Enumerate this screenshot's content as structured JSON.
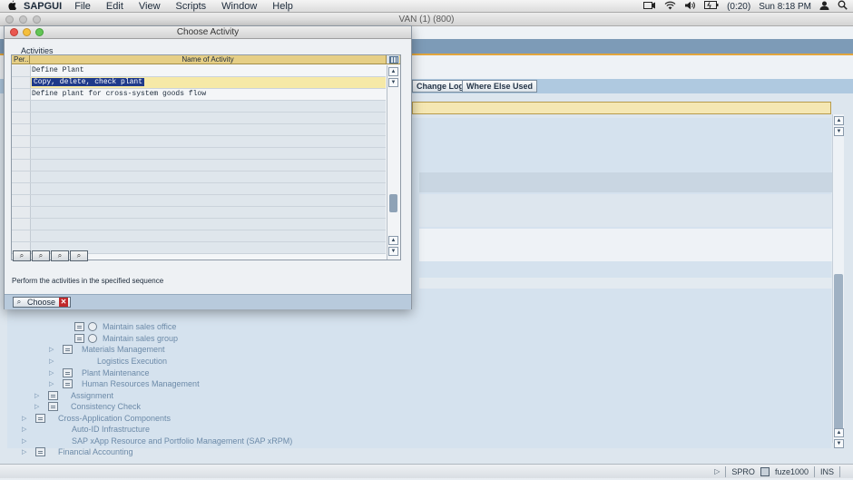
{
  "menubar": {
    "app": "SAPGUI",
    "items": [
      "File",
      "Edit",
      "View",
      "Scripts",
      "Window",
      "Help"
    ],
    "battery": "(0:20)",
    "clock": "Sun 8:18 PM"
  },
  "background_window": {
    "title": "VAN (1) (800)",
    "toolbar": {
      "change_log": "Change Log",
      "where_else_used": "Where Else Used"
    },
    "tree": [
      {
        "label": "Maintain sales office",
        "icons": [
          "doc",
          "clock"
        ]
      },
      {
        "label": "Maintain sales group",
        "icons": [
          "doc",
          "clock"
        ]
      },
      {
        "label": "Materials Management",
        "expand": true,
        "icons": [
          "doc"
        ]
      },
      {
        "label": "Logistics Execution",
        "expand": true,
        "icons": []
      },
      {
        "label": "Plant Maintenance",
        "expand": true,
        "icons": [
          "doc"
        ]
      },
      {
        "label": "Human Resources Management",
        "expand": true,
        "icons": [
          "doc"
        ]
      },
      {
        "label": "Assignment",
        "expand": true,
        "icons": [
          "doc"
        ]
      },
      {
        "label": "Consistency Check",
        "expand": true,
        "icons": [
          "doc"
        ]
      },
      {
        "label": "Cross-Application Components",
        "expand": true,
        "icons": [
          "doc"
        ]
      },
      {
        "label": "Auto-ID Infrastructure",
        "expand": true,
        "icons": []
      },
      {
        "label": "SAP xApp Resource and Portfolio Management (SAP xRPM)",
        "expand": true,
        "icons": []
      },
      {
        "label": "Financial Accounting",
        "expand": true,
        "icons": [
          "doc"
        ]
      }
    ]
  },
  "dialog": {
    "title": "Choose Activity",
    "group_label": "Activities",
    "columns": {
      "per": "Per..",
      "name": "Name of Activity"
    },
    "rows": [
      {
        "name": "Define Plant",
        "selected": false
      },
      {
        "name": "Copy, delete, check plant",
        "selected": true
      },
      {
        "name": "Define plant for cross-system goods flow",
        "selected": false
      },
      {
        "name": "",
        "selected": false
      },
      {
        "name": "",
        "selected": false
      },
      {
        "name": "",
        "selected": false
      },
      {
        "name": "",
        "selected": false
      },
      {
        "name": "",
        "selected": false
      },
      {
        "name": "",
        "selected": false
      },
      {
        "name": "",
        "selected": false
      },
      {
        "name": "",
        "selected": false
      },
      {
        "name": "",
        "selected": false
      },
      {
        "name": "",
        "selected": false
      },
      {
        "name": "",
        "selected": false
      },
      {
        "name": "",
        "selected": false
      },
      {
        "name": "",
        "selected": false
      }
    ],
    "hint": "Perform the activities in the specified sequence",
    "choose_label": "Choose",
    "cancel_glyph": "✕"
  },
  "statusbar": {
    "transaction": "SPRO",
    "server": "fuze1000",
    "mode": "INS"
  },
  "colors": {
    "selection": "#1f3a8a",
    "header_gold": "#e6cf86",
    "toolbar_blue": "#afc9e0"
  }
}
